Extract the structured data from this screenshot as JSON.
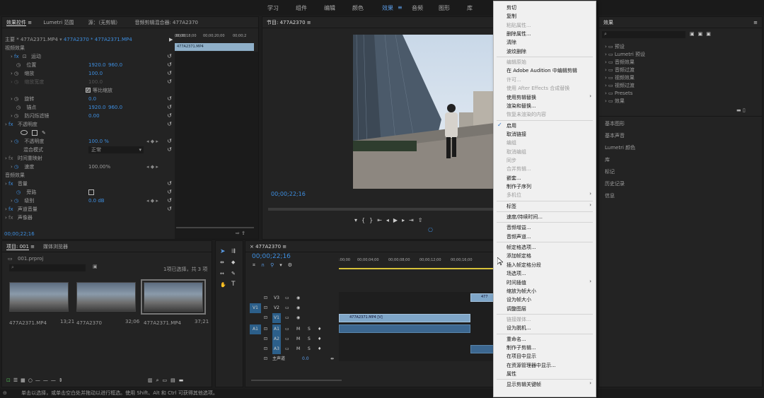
{
  "workspaces": [
    "学习",
    "组件",
    "编辑",
    "颜色",
    "效果",
    "音频",
    "图形",
    "库"
  ],
  "effect_controls": {
    "tabs": [
      "效果控件",
      "Lumetri 范围",
      "源：（无剪辑）",
      "音频剪辑混合器: 477A2370"
    ],
    "clip_header": "主要 * 477A2371.MP4",
    "clip_selected": "477A2370 * 477A2371.MP4",
    "timecodes": [
      ";00;00",
      "00;00;18;00",
      "00;00;20;00",
      "00;00;2"
    ],
    "clip_bar": "477A2371.MP4",
    "video_effects": "视频效果",
    "motion": "运动",
    "position": {
      "label": "位置",
      "x": "1920.0",
      "y": "960.0"
    },
    "scale": {
      "label": "缩放",
      "value": "100.0"
    },
    "scale_width": {
      "label": "缩放宽度",
      "value": "100.0"
    },
    "uniform_scale": "等比缩放",
    "rotation": {
      "label": "旋转",
      "value": "0.0"
    },
    "anchor": {
      "label": "锚点",
      "x": "1920.0",
      "y": "960.0"
    },
    "antiflicker": {
      "label": "防闪烁滤镜",
      "value": "0.00"
    },
    "opacity": "不透明度",
    "opacity_val": {
      "label": "不透明度",
      "value": "100.0 %"
    },
    "blend": {
      "label": "混合模式",
      "value": "正常"
    },
    "time_remap": "时间重映射",
    "speed": {
      "label": "速度",
      "value": "100.00%"
    },
    "audio_effects": "音频效果",
    "volume": "音量",
    "bypass": "旁路",
    "level": {
      "label": "级别",
      "value": "0.0 dB"
    },
    "channel_volume": "声道音量",
    "panner": "声像器",
    "timecode": "00;00;22;16"
  },
  "program": {
    "title": "节目: 477A2370",
    "timecode": "00;00;22;16"
  },
  "project": {
    "tabs": [
      "项目: 001",
      "媒体浏览器"
    ],
    "file": "001.prproj",
    "selection_info": "1项已选择，共 3 项",
    "items": [
      {
        "name": "477A2371.MP4",
        "dur": "13;21"
      },
      {
        "name": "477A2370",
        "dur": "32;06"
      },
      {
        "name": "477A2371.MP4",
        "dur": "37;21"
      }
    ]
  },
  "timeline": {
    "tab": "477A2370",
    "timecode": "00;00;22;16",
    "ruler": [
      ":00;00",
      "00;00;04;00",
      "00;00;08;00",
      "00;00;12;00",
      "00;00;16;00"
    ],
    "tracks": [
      "V3",
      "V2",
      "V1",
      "A1",
      "A2",
      "A3"
    ],
    "src_v": "V1",
    "src_a": "A1",
    "master": "主声道",
    "master_val": "0.0",
    "clip_v1": "477A2371.MP4 [V]",
    "clip_v3": "477",
    "mute": "M",
    "solo": "S"
  },
  "right_panel": {
    "effects_title": "效果",
    "tree": [
      "预设",
      "Lumetri 预设",
      "音频效果",
      "音频过渡",
      "视频效果",
      "视频过渡",
      "Presets",
      "效果"
    ],
    "panels": [
      "基本图形",
      "基本声音",
      "Lumetri 颜色",
      "库",
      "标记",
      "历史记录",
      "信息"
    ]
  },
  "context_menu": [
    {
      "label": "剪切",
      "dis": false
    },
    {
      "label": "复制",
      "dis": false
    },
    {
      "label": "粘贴属性...",
      "dis": true
    },
    {
      "label": "删除属性...",
      "dis": false
    },
    {
      "label": "清除",
      "dis": false
    },
    {
      "label": "波纹删除",
      "dis": false
    },
    {
      "sep": true
    },
    {
      "label": "编辑原始",
      "dis": true
    },
    {
      "label": "在 Adobe Audition 中编辑剪辑",
      "dis": false
    },
    {
      "label": "许可...",
      "dis": true
    },
    {
      "label": "使用 After Effects 合成替换",
      "dis": true
    },
    {
      "label": "使用剪辑替换",
      "dis": false,
      "sub": true
    },
    {
      "label": "渲染和替换...",
      "dis": false
    },
    {
      "label": "恢复未渲染的内容",
      "dis": true
    },
    {
      "sep": true
    },
    {
      "label": "启用",
      "dis": false,
      "check": true
    },
    {
      "label": "取消链接",
      "dis": false
    },
    {
      "label": "编组",
      "dis": true
    },
    {
      "label": "取消编组",
      "dis": true
    },
    {
      "label": "同步",
      "dis": true
    },
    {
      "label": "合并剪辑...",
      "dis": true
    },
    {
      "label": "嵌套...",
      "dis": false
    },
    {
      "label": "制作子序列",
      "dis": false
    },
    {
      "label": "多机位",
      "dis": true,
      "sub": true
    },
    {
      "sep": true
    },
    {
      "label": "标签",
      "dis": false,
      "sub": true
    },
    {
      "sep": true
    },
    {
      "label": "速度/持续时间...",
      "dis": false
    },
    {
      "sep": true
    },
    {
      "label": "音频增益...",
      "dis": false
    },
    {
      "label": "音频声道...",
      "dis": false
    },
    {
      "sep": true
    },
    {
      "label": "帧定格选项...",
      "dis": false
    },
    {
      "label": "添加帧定格",
      "dis": false
    },
    {
      "label": "插入帧定格分段",
      "dis": false
    },
    {
      "label": "场选项...",
      "dis": false
    },
    {
      "label": "时间插值",
      "dis": false,
      "sub": true
    },
    {
      "label": "缩放为帧大小",
      "dis": false
    },
    {
      "label": "设为帧大小",
      "dis": false
    },
    {
      "label": "调整图层",
      "dis": false
    },
    {
      "sep": true
    },
    {
      "label": "链接媒体...",
      "dis": true
    },
    {
      "label": "设为脱机...",
      "dis": false
    },
    {
      "sep": true
    },
    {
      "label": "重命名...",
      "dis": false
    },
    {
      "label": "制作子剪辑...",
      "dis": false
    },
    {
      "label": "在项目中显示",
      "dis": false
    },
    {
      "label": "在资源管理器中显示...",
      "dis": false
    },
    {
      "label": "属性",
      "dis": false
    },
    {
      "sep": true
    },
    {
      "label": "显示剪辑关键帧",
      "dis": false,
      "sub": true
    }
  ],
  "status": "单击以选择，或单击空白处并拖动以进行框选。使用 Shift、Alt 和 Ctrl 可获得其他选项。"
}
